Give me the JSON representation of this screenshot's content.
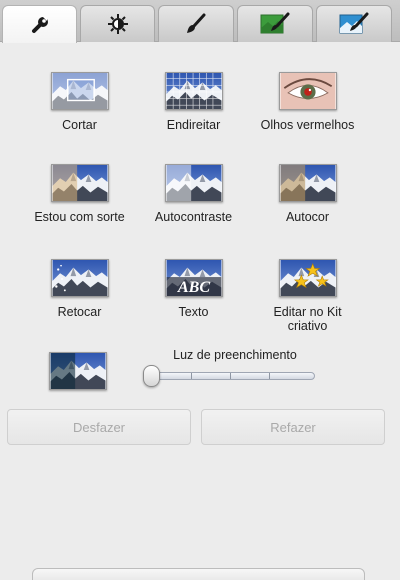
{
  "tabs": [
    {
      "icon": "wrench-icon",
      "active": true
    },
    {
      "icon": "brightness-icon",
      "active": false
    },
    {
      "icon": "brush-icon",
      "active": false
    },
    {
      "icon": "green-photo-brush-icon",
      "active": false
    },
    {
      "icon": "blue-photo-brush-icon",
      "active": false
    }
  ],
  "tools": [
    {
      "label": "Cortar",
      "icon": "crop-thumbnail"
    },
    {
      "label": "Endireitar",
      "icon": "straighten-thumbnail"
    },
    {
      "label": "Olhos vermelhos",
      "icon": "red-eye-thumbnail"
    },
    {
      "label": "Estou com sorte",
      "icon": "im-feeling-lucky-thumbnail"
    },
    {
      "label": "Autocontraste",
      "icon": "auto-contrast-thumbnail"
    },
    {
      "label": "Autocor",
      "icon": "auto-color-thumbnail"
    },
    {
      "label": "Retocar",
      "icon": "retouch-thumbnail"
    },
    {
      "label": "Texto",
      "icon": "text-thumbnail",
      "thumb_text": "ABC"
    },
    {
      "label": "Editar no Kit\ncriativo",
      "icon": "creative-kit-thumbnail"
    }
  ],
  "fill_light": {
    "label": "Luz de preenchimento",
    "icon": "fill-light-thumbnail",
    "value": 0
  },
  "buttons": {
    "undo": "Desfazer",
    "redo": "Refazer"
  },
  "colors": {
    "background": "#ececec",
    "disabled_text": "#a9a9a9",
    "sky": "#3f63b6",
    "snow": "#f2f2f2",
    "rock": "#3a3f4a"
  }
}
